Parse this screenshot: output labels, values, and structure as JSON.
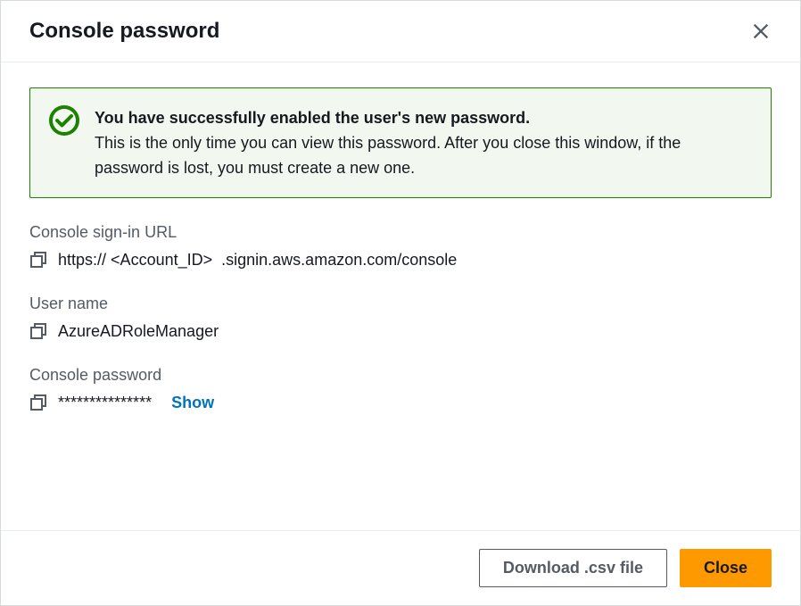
{
  "header": {
    "title": "Console password"
  },
  "alert": {
    "title": "You have successfully enabled the user's new password.",
    "text": "This is the only time you can view this password. After you close this window, if the password is lost, you must create a new one."
  },
  "fields": {
    "url": {
      "label": "Console sign-in URL",
      "value_prefix": "https://",
      "value_account": "<Account_ID>",
      "value_suffix": ".signin.aws.amazon.com/console"
    },
    "username": {
      "label": "User name",
      "value": "AzureADRoleManager"
    },
    "password": {
      "label": "Console password",
      "value": "***************",
      "show_label": "Show"
    }
  },
  "footer": {
    "download_label": "Download .csv file",
    "close_label": "Close"
  }
}
